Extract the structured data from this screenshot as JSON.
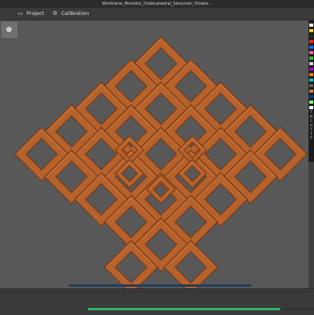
{
  "window": {
    "title": "Wireframe_Rhombic_Dodecahedral_Sierpinski_Octahe..."
  },
  "menu": {
    "tabs": [
      {
        "label": "Project",
        "icon": "folder-icon"
      },
      {
        "label": "Calibration",
        "icon": "gear-icon"
      }
    ]
  },
  "viewport": {
    "model_color": "#b6622c",
    "model_edge_color": "#7a3a16",
    "platform_color": "#1f3d5c",
    "background": "#585858"
  },
  "palette": {
    "colors": [
      "#ffffff",
      "#ffd000",
      "#2a2a2a",
      "#ff2020",
      "#0070ff",
      "#ff60a0",
      "#30c030",
      "#d0d0d0",
      "#a000c0",
      "#ff8000",
      "#00c0c0",
      "#606060",
      "#c08040",
      "#004080",
      "#80ff80",
      "#ffffff"
    ],
    "letters": [
      "T",
      "M",
      "C",
      "H",
      "S",
      "T",
      "P"
    ]
  },
  "progress": {
    "fraction": 0.85,
    "color": "#2fb36a"
  }
}
